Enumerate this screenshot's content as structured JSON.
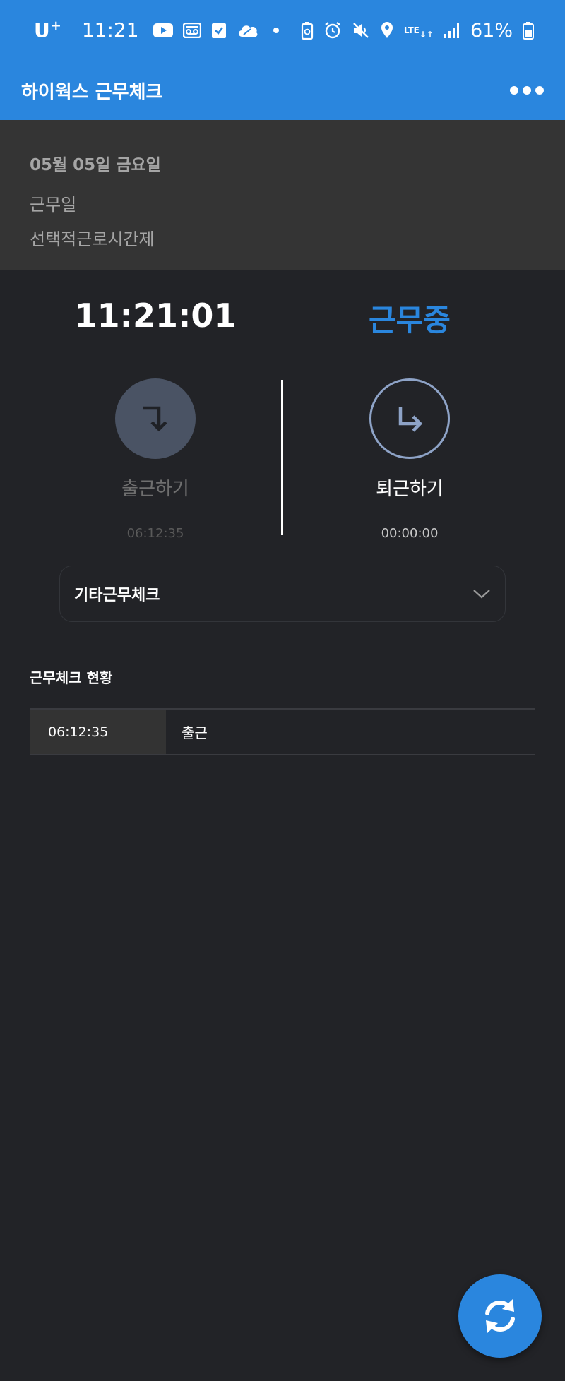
{
  "status_bar": {
    "carrier": "U",
    "carrier_plus": "+",
    "time": "11:21",
    "network": "LTE",
    "battery": "61%",
    "icons": [
      "youtube-icon",
      "voicemail-icon",
      "checklist-icon",
      "cloud-icon",
      "notification-dot-icon",
      "battery-saver-icon",
      "alarm-icon",
      "mute-icon",
      "location-icon",
      "lte-icon",
      "signal-icon",
      "battery-icon"
    ]
  },
  "app_bar": {
    "title": "하이웍스 근무체크",
    "menu_icon": "more-horizontal-icon"
  },
  "date_panel": {
    "date": "05월 05일 금요일",
    "day_type": "근무일",
    "schedule_type": "선택적근로시간제"
  },
  "clock": {
    "time": "11:21:01",
    "status": "근무중"
  },
  "punch_in": {
    "label": "출근하기",
    "time": "06:12:35",
    "icon": "clock-in-arrow-icon"
  },
  "punch_out": {
    "label": "퇴근하기",
    "time": "00:00:00",
    "icon": "clock-out-arrow-icon"
  },
  "other_check": {
    "label": "기타근무체크",
    "icon": "chevron-down-icon"
  },
  "records": {
    "title": "근무체크 현황",
    "rows": [
      {
        "time": "06:12:35",
        "type": "출근"
      }
    ]
  },
  "fab": {
    "icon": "refresh-icon"
  },
  "colors": {
    "primary": "#2a86de",
    "background": "#222327",
    "panel": "#343434"
  }
}
